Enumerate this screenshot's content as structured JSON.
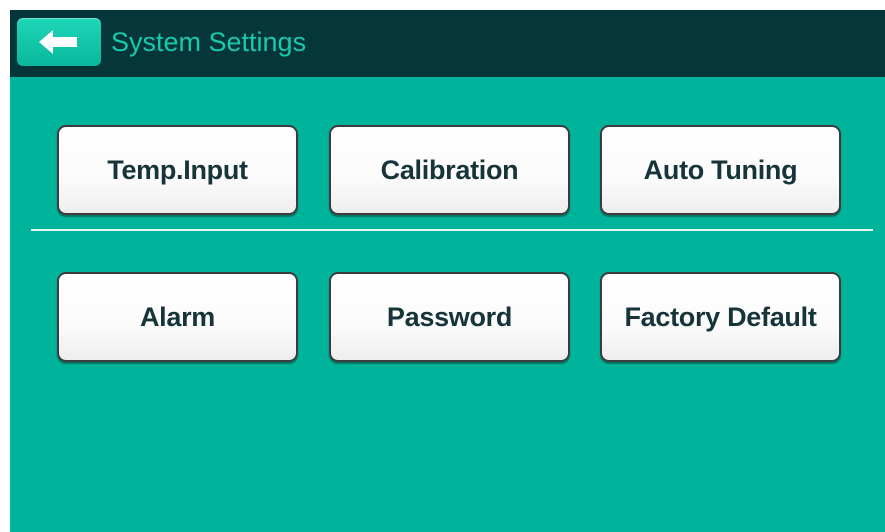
{
  "header": {
    "title": "System Settings",
    "back_icon": "arrow-left-icon"
  },
  "menu": {
    "row1": [
      {
        "label": "Temp.Input"
      },
      {
        "label": "Calibration"
      },
      {
        "label": "Auto Tuning"
      }
    ],
    "row2": [
      {
        "label": "Alarm"
      },
      {
        "label": "Password"
      },
      {
        "label": "Factory Default"
      }
    ]
  },
  "colors": {
    "background": "#00b39b",
    "header": "#05363a",
    "title": "#19c9ad",
    "button_text": "#16343a"
  }
}
